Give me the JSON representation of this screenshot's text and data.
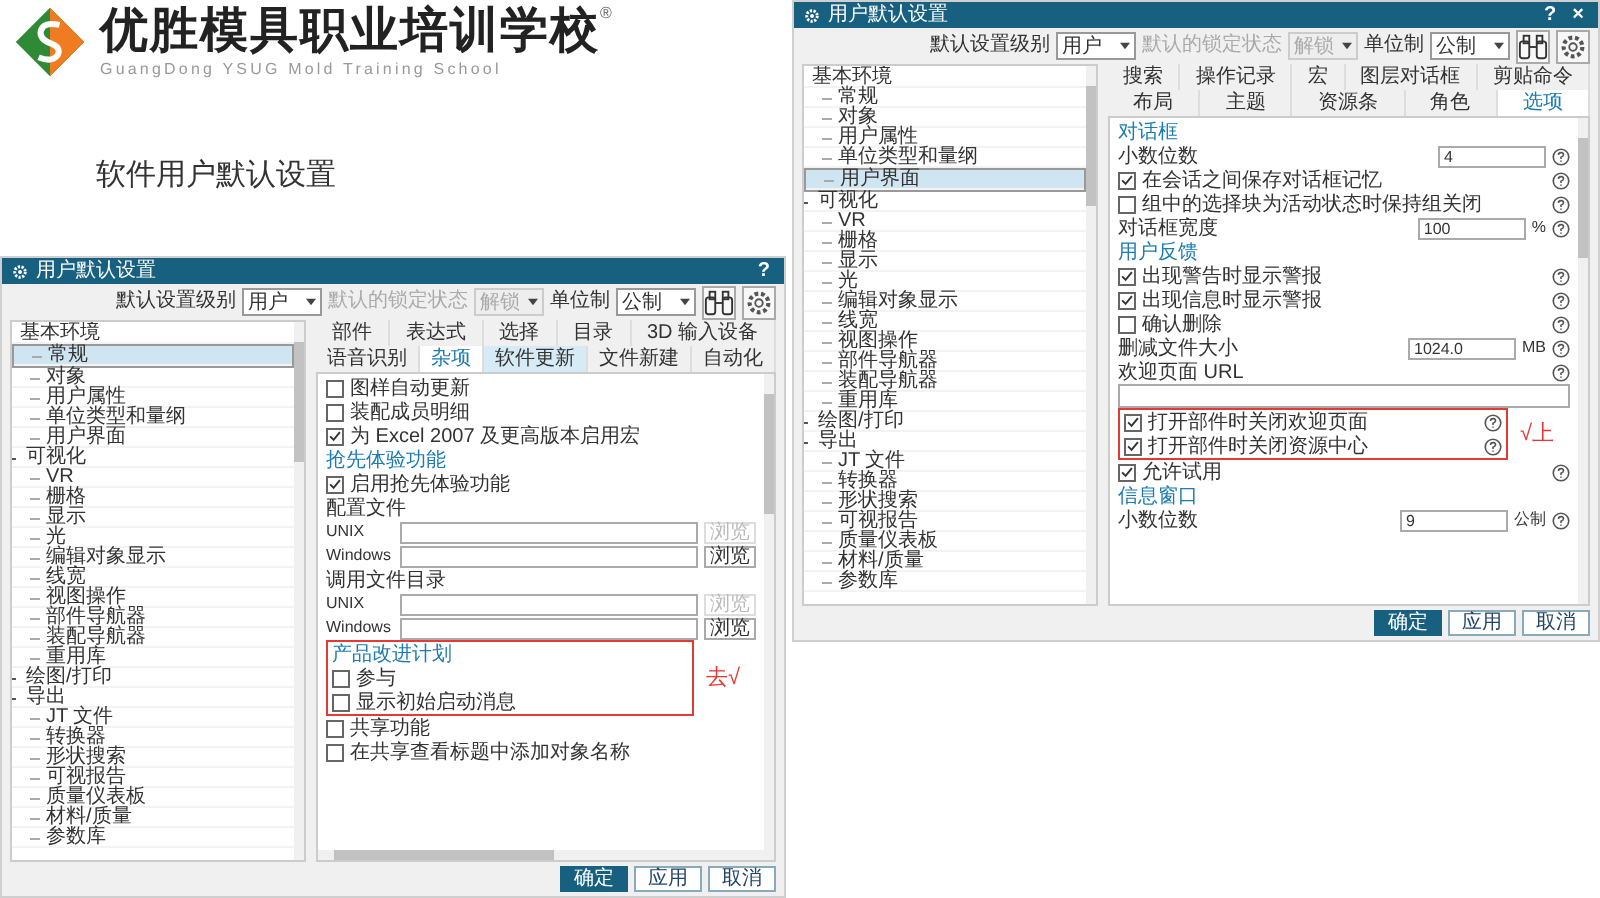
{
  "slide": {
    "school_name": "优胜模具职业培训学校",
    "registered": "®",
    "school_name_en": "GuangDong YSUG Mold Training School",
    "title": "软件用户默认设置"
  },
  "dialogs": [
    {
      "title": "用户默认设置",
      "help": "?",
      "toolbar": [
        {
          "label": "默认设置级别",
          "value": "用户",
          "disabled": false
        },
        {
          "label": "默认的锁定状态",
          "value": "解锁",
          "disabled": true
        },
        {
          "label": "单位制",
          "value": "公制",
          "disabled": false
        }
      ],
      "tree": [
        {
          "label": "基本环境",
          "expandable": false,
          "selected": false,
          "children": [
            {
              "label": "常规",
              "expandable": false,
              "selected": true
            },
            {
              "label": "对象",
              "expandable": false,
              "selected": false
            },
            {
              "label": "用户属性",
              "expandable": false,
              "selected": false
            },
            {
              "label": "单位类型和量纲",
              "expandable": false,
              "selected": false
            },
            {
              "label": "用户界面",
              "expandable": false,
              "selected": false
            }
          ]
        },
        {
          "label": "可视化",
          "expandable": true,
          "selected": false,
          "children": [
            {
              "label": "VR",
              "expandable": false,
              "selected": false
            },
            {
              "label": "栅格",
              "expandable": false,
              "selected": false
            },
            {
              "label": "显示",
              "expandable": false,
              "selected": false
            },
            {
              "label": "光",
              "expandable": false,
              "selected": false
            },
            {
              "label": "编辑对象显示",
              "expandable": false,
              "selected": false
            },
            {
              "label": "线宽",
              "expandable": false,
              "selected": false
            },
            {
              "label": "视图操作",
              "expandable": false,
              "selected": false
            },
            {
              "label": "部件导航器",
              "expandable": false,
              "selected": false
            },
            {
              "label": "装配导航器",
              "expandable": false,
              "selected": false
            },
            {
              "label": "重用库",
              "expandable": false,
              "selected": false
            }
          ]
        },
        {
          "label": "绘图/打印",
          "expandable": true,
          "selected": false
        },
        {
          "label": "导出",
          "expandable": true,
          "selected": false,
          "children": [
            {
              "label": "JT 文件",
              "expandable": false,
              "selected": false
            },
            {
              "label": "转换器",
              "expandable": false,
              "selected": false
            },
            {
              "label": "形状搜索",
              "expandable": false,
              "selected": false
            },
            {
              "label": "可视报告",
              "expandable": false,
              "selected": false
            },
            {
              "label": "质量仪表板",
              "expandable": false,
              "selected": false
            },
            {
              "label": "材料/质量",
              "expandable": false,
              "selected": false
            },
            {
              "label": "参数库",
              "expandable": false,
              "selected": false
            }
          ]
        }
      ],
      "tab_rows": [
        [
          {
            "label": "部件",
            "selected": false,
            "hovered": false
          },
          {
            "label": "表达式",
            "selected": false,
            "hovered": false
          },
          {
            "label": "选择",
            "selected": false,
            "hovered": false
          },
          {
            "label": "目录",
            "selected": false,
            "hovered": false
          },
          {
            "label": "3D 输入设备",
            "selected": false,
            "hovered": false
          }
        ],
        [
          {
            "label": "语音识别",
            "selected": false,
            "hovered": false
          },
          {
            "label": "杂项",
            "selected": true,
            "hovered": false
          },
          {
            "label": "软件更新",
            "selected": false,
            "hovered": true
          },
          {
            "label": "文件新建",
            "selected": false,
            "hovered": false
          },
          {
            "label": "自动化",
            "selected": false,
            "hovered": false
          }
        ]
      ],
      "content": [
        {
          "kind": "check",
          "label": "图样自动更新",
          "checked": false,
          "help": false
        },
        {
          "kind": "check",
          "label": "装配成员明细",
          "checked": false,
          "help": false
        },
        {
          "kind": "check",
          "label": "为 Excel 2007 及更高版本启用宏",
          "checked": true,
          "help": false
        },
        {
          "kind": "section",
          "label": "抢先体验功能"
        },
        {
          "kind": "check",
          "label": "启用抢先体验功能",
          "checked": true,
          "help": false
        },
        {
          "kind": "label",
          "label": "配置文件",
          "help": false
        },
        {
          "kind": "path",
          "label": "UNIX",
          "button": "浏览",
          "disabled": true
        },
        {
          "kind": "path",
          "label": "Windows",
          "button": "浏览",
          "disabled": false
        },
        {
          "kind": "label",
          "label": "调用文件目录",
          "help": false
        },
        {
          "kind": "path",
          "label": "UNIX",
          "button": "浏览",
          "disabled": true
        },
        {
          "kind": "path",
          "label": "Windows",
          "button": "浏览",
          "disabled": false
        },
        {
          "kind": "group",
          "note": "去√",
          "items": [
            {
              "kind": "section",
              "label": "产品改进计划"
            },
            {
              "kind": "check",
              "label": "参与",
              "checked": false,
              "help": false
            },
            {
              "kind": "check",
              "label": "显示初始启动消息",
              "checked": false,
              "help": false
            }
          ]
        },
        {
          "kind": "check",
          "label": "共享功能",
          "checked": false,
          "help": false
        },
        {
          "kind": "check",
          "label": "在共享查看标题中添加对象名称",
          "checked": false,
          "help": false
        }
      ],
      "hscroll": true,
      "buttons": [
        {
          "label": "确定",
          "primary": true
        },
        {
          "label": "应用",
          "primary": false
        },
        {
          "label": "取消",
          "primary": false
        }
      ]
    },
    {
      "title": "用户默认设置",
      "help": "?",
      "close": "×",
      "toolbar": [
        {
          "label": "默认设置级别",
          "value": "用户",
          "disabled": false
        },
        {
          "label": "默认的锁定状态",
          "value": "解锁",
          "disabled": true
        },
        {
          "label": "单位制",
          "value": "公制",
          "disabled": false
        }
      ],
      "tree": [
        {
          "label": "基本环境",
          "expandable": false,
          "selected": false,
          "children": [
            {
              "label": "常规",
              "expandable": false,
              "selected": false
            },
            {
              "label": "对象",
              "expandable": false,
              "selected": false
            },
            {
              "label": "用户属性",
              "expandable": false,
              "selected": false
            },
            {
              "label": "单位类型和量纲",
              "expandable": false,
              "selected": false
            },
            {
              "label": "用户界面",
              "expandable": false,
              "selected": true
            }
          ]
        },
        {
          "label": "可视化",
          "expandable": true,
          "selected": false,
          "children": [
            {
              "label": "VR",
              "expandable": false,
              "selected": false
            },
            {
              "label": "栅格",
              "expandable": false,
              "selected": false
            },
            {
              "label": "显示",
              "expandable": false,
              "selected": false
            },
            {
              "label": "光",
              "expandable": false,
              "selected": false
            },
            {
              "label": "编辑对象显示",
              "expandable": false,
              "selected": false
            },
            {
              "label": "线宽",
              "expandable": false,
              "selected": false
            },
            {
              "label": "视图操作",
              "expandable": false,
              "selected": false
            },
            {
              "label": "部件导航器",
              "expandable": false,
              "selected": false
            },
            {
              "label": "装配导航器",
              "expandable": false,
              "selected": false
            },
            {
              "label": "重用库",
              "expandable": false,
              "selected": false
            }
          ]
        },
        {
          "label": "绘图/打印",
          "expandable": true,
          "selected": false
        },
        {
          "label": "导出",
          "expandable": true,
          "selected": false,
          "children": [
            {
              "label": "JT 文件",
              "expandable": false,
              "selected": false
            },
            {
              "label": "转换器",
              "expandable": false,
              "selected": false
            },
            {
              "label": "形状搜索",
              "expandable": false,
              "selected": false
            },
            {
              "label": "可视报告",
              "expandable": false,
              "selected": false
            },
            {
              "label": "质量仪表板",
              "expandable": false,
              "selected": false
            },
            {
              "label": "材料/质量",
              "expandable": false,
              "selected": false
            },
            {
              "label": "参数库",
              "expandable": false,
              "selected": false
            }
          ]
        }
      ],
      "tab_rows": [
        [
          {
            "label": "搜索",
            "selected": false,
            "hovered": false
          },
          {
            "label": "操作记录",
            "selected": false,
            "hovered": false
          },
          {
            "label": "宏",
            "selected": false,
            "hovered": false
          },
          {
            "label": "图层对话框",
            "selected": false,
            "hovered": false
          },
          {
            "label": "剪贴命令",
            "selected": false,
            "hovered": false
          }
        ],
        [
          {
            "label": "布局",
            "selected": false,
            "hovered": false
          },
          {
            "label": "主题",
            "selected": false,
            "hovered": false
          },
          {
            "label": "资源条",
            "selected": false,
            "hovered": false
          },
          {
            "label": "角色",
            "selected": false,
            "hovered": false
          },
          {
            "label": "选项",
            "selected": true,
            "hovered": false
          }
        ]
      ],
      "content": [
        {
          "kind": "section",
          "label": "对话框"
        },
        {
          "kind": "number",
          "label": "小数位数",
          "value": "4",
          "help": true
        },
        {
          "kind": "check",
          "label": "在会话之间保存对话框记忆",
          "checked": true,
          "help": true
        },
        {
          "kind": "check",
          "label": "组中的选择块为活动状态时保持组关闭",
          "checked": false,
          "help": true
        },
        {
          "kind": "number",
          "label": "对话框宽度",
          "value": "100",
          "unit": "%",
          "help": true
        },
        {
          "kind": "section",
          "label": "用户反馈"
        },
        {
          "kind": "check",
          "label": "出现警告时显示警报",
          "checked": true,
          "help": true
        },
        {
          "kind": "check",
          "label": "出现信息时显示警报",
          "checked": true,
          "help": true
        },
        {
          "kind": "check",
          "label": "确认删除",
          "checked": false,
          "help": true
        },
        {
          "kind": "number",
          "label": "删减文件大小",
          "value": "1024.0",
          "unit": "MB",
          "help": true
        },
        {
          "kind": "label",
          "label": "欢迎页面 URL",
          "help": true
        },
        {
          "kind": "field"
        },
        {
          "kind": "group",
          "note": "√上",
          "items": [
            {
              "kind": "check",
              "label": "打开部件时关闭欢迎页面",
              "checked": true,
              "help": true
            },
            {
              "kind": "check",
              "label": "打开部件时关闭资源中心",
              "checked": true,
              "help": true
            }
          ]
        },
        {
          "kind": "check",
          "label": "允许试用",
          "checked": true,
          "help": true
        },
        {
          "kind": "section",
          "label": "信息窗口"
        },
        {
          "kind": "number",
          "label": "小数位数",
          "value": "9",
          "unit": "公制",
          "help": true
        }
      ],
      "hscroll": false,
      "buttons": [
        {
          "label": "确定",
          "primary": true
        },
        {
          "label": "应用",
          "primary": false
        },
        {
          "label": "取消",
          "primary": false
        }
      ]
    }
  ]
}
